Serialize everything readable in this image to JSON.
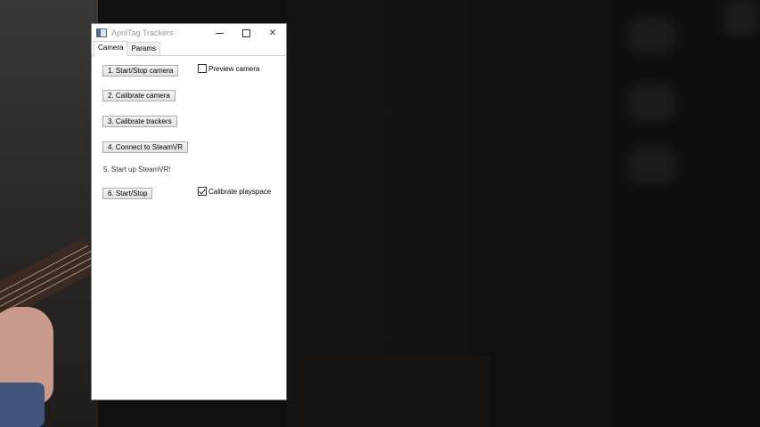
{
  "window": {
    "title": "AprilTag Trackers",
    "icon": "app-window-icon",
    "controls": [
      "minimize-icon",
      "maximize-icon",
      "close-icon"
    ],
    "close_glyph": "✕"
  },
  "tabs": [
    {
      "label": "Camera",
      "active": true
    },
    {
      "label": "Params",
      "active": false
    }
  ],
  "camera_tab": {
    "start_stop_camera": "1. Start/Stop camera",
    "preview_camera": {
      "label": "Preview camera",
      "checked": false
    },
    "calibrate_camera": "2. Calibrate camera",
    "calibrate_trackers": "3. Calibrate trackers",
    "connect_steamvr": "4. Connect to SteamVR",
    "start_steamvr_note": "5. Start up SteamVR!",
    "start_stop": "6. Start/Stop",
    "calibrate_playspace": {
      "label": "Calibrate playspace",
      "checked": true
    }
  },
  "colors": {
    "window_bg": "#ffffff",
    "button_bg": "#e1e1e1",
    "button_border": "#adadad",
    "desktop_bg": "#111111"
  }
}
